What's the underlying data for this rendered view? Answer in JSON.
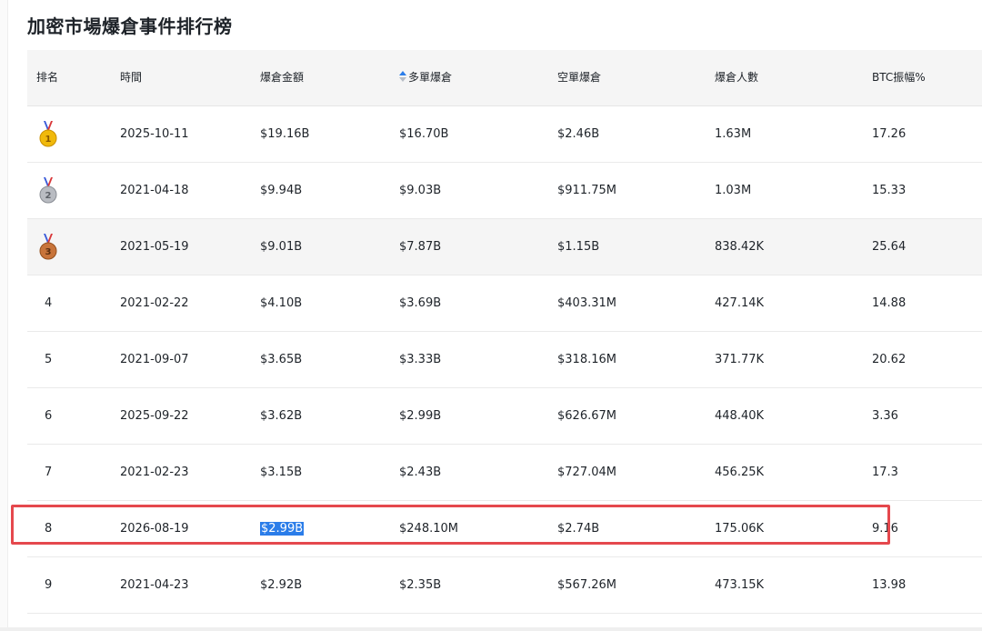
{
  "page": {
    "title": "加密市場爆倉事件排行榜"
  },
  "table": {
    "headers": [
      "排名",
      "時間",
      "爆倉金額",
      "多單爆倉",
      "空單爆倉",
      "爆倉人數",
      "BTC振幅%"
    ],
    "sorted_column_icon": "sort-updown-icon",
    "rows": [
      {
        "rank": "1",
        "medal": "gold-medal-icon",
        "date": "2025-10-11",
        "total": "$19.16B",
        "long": "$16.70B",
        "short": "$2.46B",
        "count": "1.63M",
        "btc": "17.26"
      },
      {
        "rank": "2",
        "medal": "silver-medal-icon",
        "date": "2021-04-18",
        "total": "$9.94B",
        "long": "$9.03B",
        "short": "$911.75M",
        "count": "1.03M",
        "btc": "15.33"
      },
      {
        "rank": "3",
        "medal": "bronze-medal-icon",
        "date": "2021-05-19",
        "total": "$9.01B",
        "long": "$7.87B",
        "short": "$1.15B",
        "count": "838.42K",
        "btc": "25.64"
      },
      {
        "rank": "4",
        "date": "2021-02-22",
        "total": "$4.10B",
        "long": "$3.69B",
        "short": "$403.31M",
        "count": "427.14K",
        "btc": "14.88"
      },
      {
        "rank": "5",
        "date": "2021-09-07",
        "total": "$3.65B",
        "long": "$3.33B",
        "short": "$318.16M",
        "count": "371.77K",
        "btc": "20.62"
      },
      {
        "rank": "6",
        "date": "2025-09-22",
        "total": "$3.62B",
        "long": "$2.99B",
        "short": "$626.67M",
        "count": "448.40K",
        "btc": "3.36"
      },
      {
        "rank": "7",
        "date": "2021-02-23",
        "total": "$3.15B",
        "long": "$2.43B",
        "short": "$727.04M",
        "count": "456.25K",
        "btc": "17.3"
      },
      {
        "rank": "8",
        "date": "2026-08-19",
        "total": "$2.99B",
        "long": "$248.10M",
        "short": "$2.74B",
        "count": "175.06K",
        "btc": "9.16"
      },
      {
        "rank": "9",
        "date": "2021-04-23",
        "total": "$2.92B",
        "long": "$2.35B",
        "short": "$567.26M",
        "count": "473.15K",
        "btc": "13.98"
      }
    ]
  },
  "colors": {
    "header_bg": "#f5f5f5",
    "stripe_bg": "#f5f5f5",
    "highlight_border": "#e5484d",
    "text_selection": "#2b7de9",
    "sort_icon_active": "#2b7de9"
  },
  "highlighted_row": "8",
  "selected_text": "$2.99B"
}
